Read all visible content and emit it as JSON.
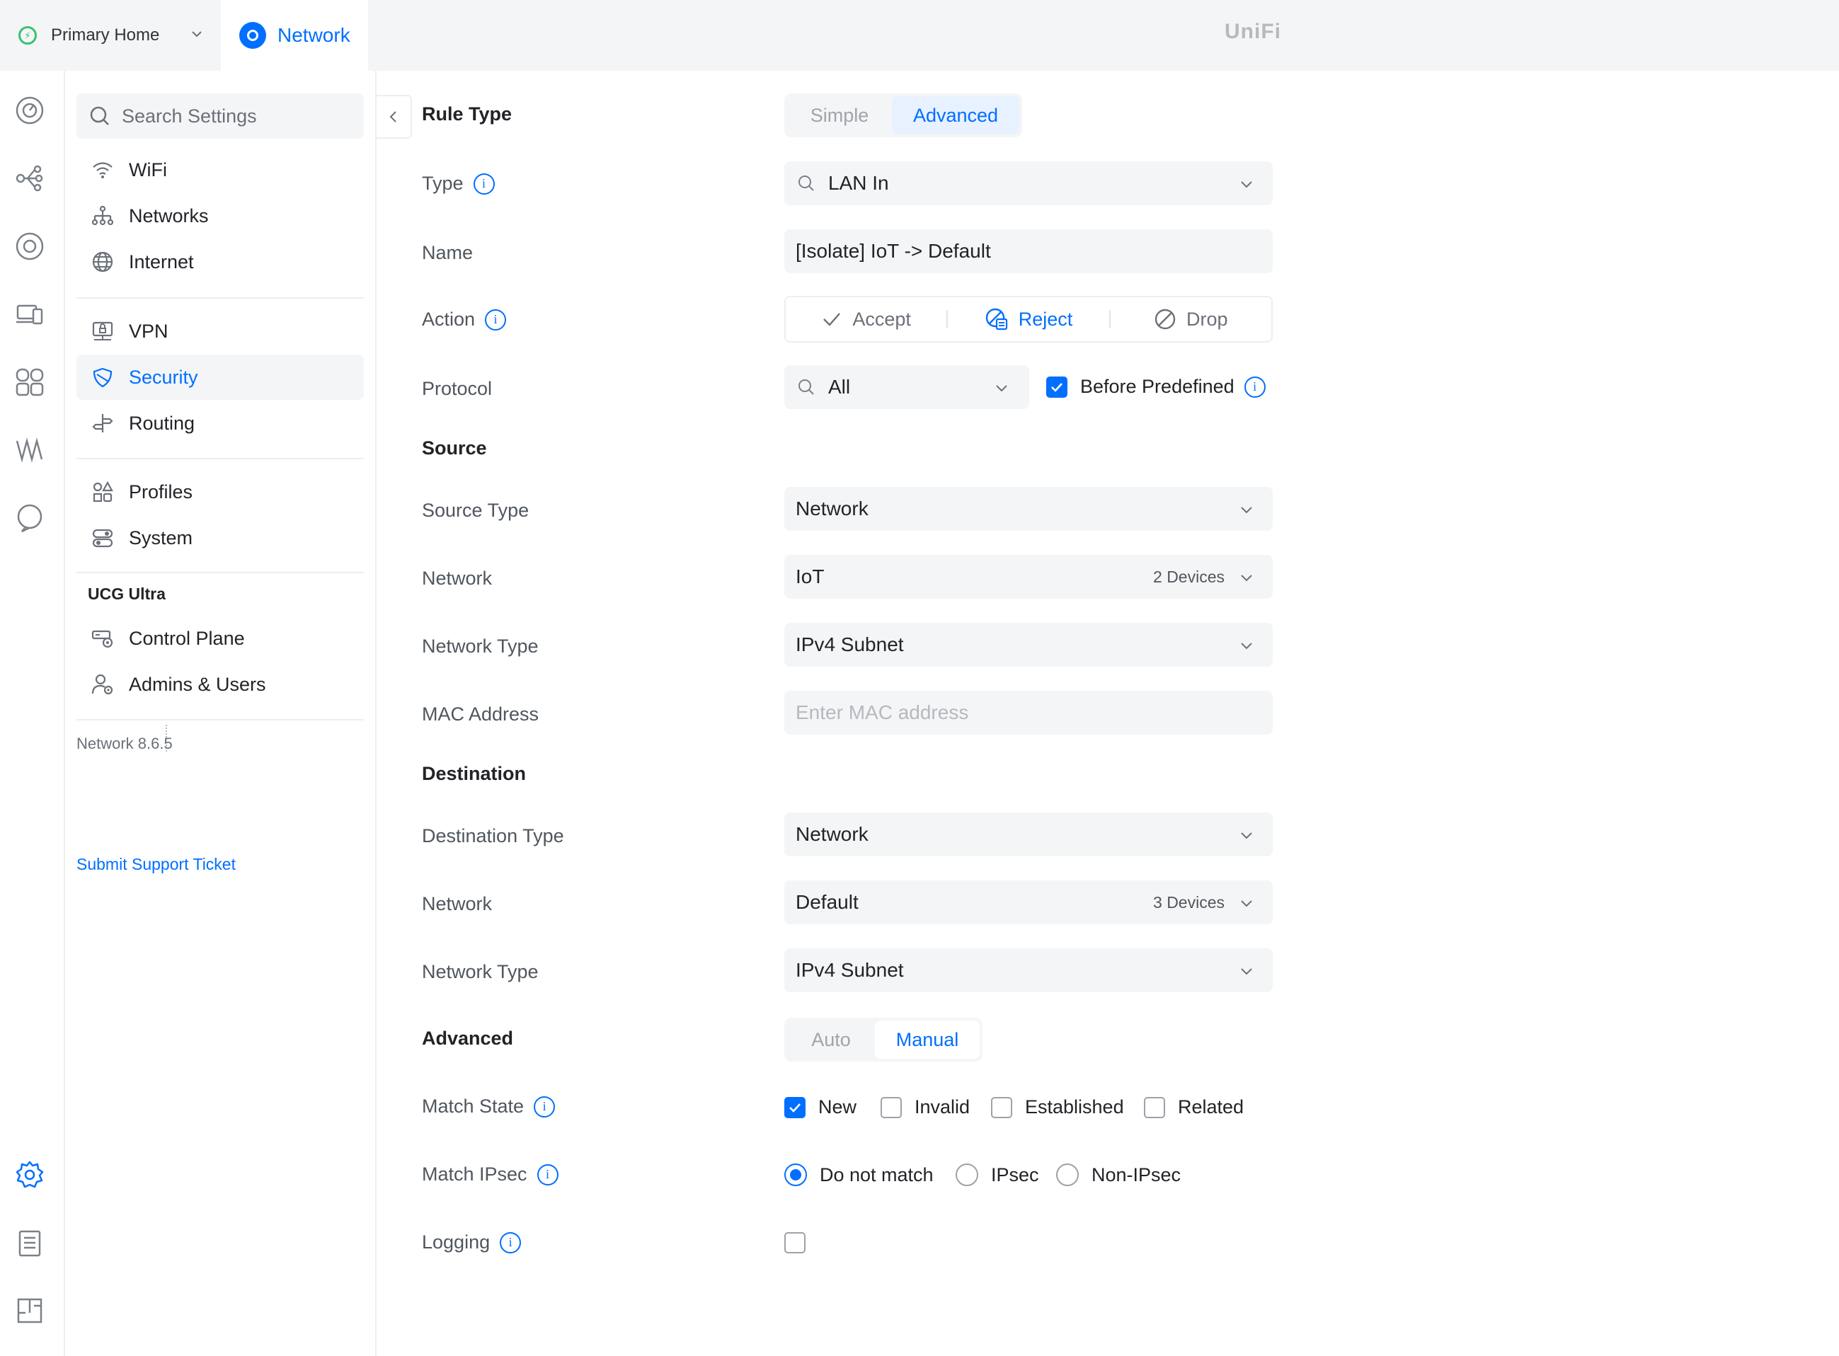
{
  "topbar": {
    "site_name": "Primary Home",
    "app_name": "Network",
    "brand": "UniFi"
  },
  "rail": {
    "icons": [
      "dashboard-icon",
      "topology-icon",
      "devices-icon",
      "clients-icon",
      "ports-icon",
      "insights-icon",
      "alerts-icon",
      "settings-icon",
      "logs-icon",
      "innerspace-icon"
    ]
  },
  "sidebar": {
    "search_placeholder": "Search Settings",
    "items": [
      {
        "label": "WiFi",
        "icon": "wifi-icon"
      },
      {
        "label": "Networks",
        "icon": "networks-icon"
      },
      {
        "label": "Internet",
        "icon": "globe-icon"
      },
      {
        "label": "VPN",
        "icon": "vpn-icon"
      },
      {
        "label": "Security",
        "icon": "shield-icon",
        "active": true
      },
      {
        "label": "Routing",
        "icon": "routing-icon"
      },
      {
        "label": "Profiles",
        "icon": "profiles-icon"
      },
      {
        "label": "System",
        "icon": "system-icon"
      }
    ],
    "device_heading": "UCG Ultra",
    "device_items": [
      {
        "label": "Control Plane",
        "icon": "control-plane-icon"
      },
      {
        "label": "Admins & Users",
        "icon": "admins-icon"
      }
    ],
    "version": "Network 8.6.5",
    "support_link": "Submit Support Ticket"
  },
  "form": {
    "rule_type": {
      "label": "Rule Type",
      "options": [
        "Simple",
        "Advanced"
      ],
      "selected": "Advanced"
    },
    "type": {
      "label": "Type",
      "value": "LAN In"
    },
    "name": {
      "label": "Name",
      "value": "[Isolate] IoT -> Default"
    },
    "action": {
      "label": "Action",
      "options": [
        "Accept",
        "Reject",
        "Drop"
      ],
      "selected": "Reject"
    },
    "protocol": {
      "label": "Protocol",
      "value": "All",
      "before_predefined_label": "Before Predefined",
      "before_predefined_checked": true
    },
    "source": {
      "heading": "Source",
      "type_label": "Source Type",
      "type_value": "Network",
      "network_label": "Network",
      "network_value": "IoT",
      "network_devices": "2 Devices",
      "network_type_label": "Network Type",
      "network_type_value": "IPv4 Subnet",
      "mac_label": "MAC Address",
      "mac_placeholder": "Enter MAC address"
    },
    "destination": {
      "heading": "Destination",
      "type_label": "Destination Type",
      "type_value": "Network",
      "network_label": "Network",
      "network_value": "Default",
      "network_devices": "3 Devices",
      "network_type_label": "Network Type",
      "network_type_value": "IPv4 Subnet"
    },
    "advanced": {
      "label": "Advanced",
      "options": [
        "Auto",
        "Manual"
      ],
      "selected": "Manual"
    },
    "match_state": {
      "label": "Match State",
      "options": [
        {
          "label": "New",
          "checked": true
        },
        {
          "label": "Invalid",
          "checked": false
        },
        {
          "label": "Established",
          "checked": false
        },
        {
          "label": "Related",
          "checked": false
        }
      ]
    },
    "match_ipsec": {
      "label": "Match IPsec",
      "options": [
        "Do not match",
        "IPsec",
        "Non-IPsec"
      ],
      "selected": "Do not match"
    },
    "logging": {
      "label": "Logging",
      "checked": false
    }
  },
  "colors": {
    "accent": "#006fff",
    "success": "#38c172",
    "field_bg": "#f4f5f6"
  }
}
